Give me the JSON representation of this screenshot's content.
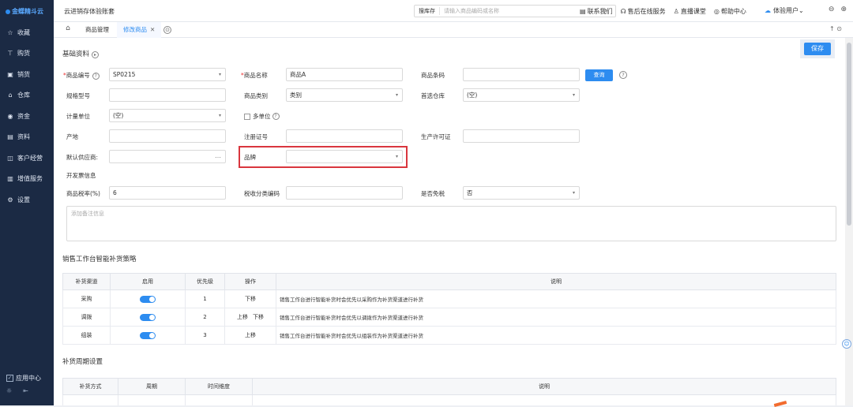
{
  "sidebar": {
    "logo": "金蝶精斗云",
    "items": [
      {
        "icon": "star-icon",
        "glyph": "☆",
        "label": "收藏"
      },
      {
        "icon": "cart-icon",
        "glyph": "⊤",
        "label": "购货"
      },
      {
        "icon": "sales-icon",
        "glyph": "▣",
        "label": "销货"
      },
      {
        "icon": "warehouse-icon",
        "glyph": "⌂",
        "label": "仓库"
      },
      {
        "icon": "money-icon",
        "glyph": "◉",
        "label": "资金"
      },
      {
        "icon": "data-icon",
        "glyph": "▤",
        "label": "资料"
      },
      {
        "icon": "customer-icon",
        "glyph": "◫",
        "label": "客户经营"
      },
      {
        "icon": "value-added-icon",
        "glyph": "▥",
        "label": "增值服务"
      },
      {
        "icon": "settings-icon",
        "glyph": "⚙",
        "label": "设置"
      }
    ],
    "app_center": "应用中心"
  },
  "topbar": {
    "title": "云进销存体验账套",
    "search_scope": "搜库存",
    "search_placeholder": "请输入商品编码或名称",
    "links": [
      "联系我们",
      "售后在线服务",
      "直播课堂",
      "帮助中心"
    ],
    "user": "体验用户"
  },
  "tabs": {
    "items": [
      {
        "label": "商品管理",
        "active": false
      },
      {
        "label": "修改商品",
        "active": true
      }
    ]
  },
  "basic_info": {
    "title": "基础资料",
    "save": "保存",
    "fields": {
      "code_label": "商品编号",
      "code_value": "SP0215",
      "name_label": "商品名称",
      "name_value": "商品A",
      "barcode_label": "商品条码",
      "barcode_value": "",
      "query_button": "查询",
      "spec_label": "规格型号",
      "category_label": "商品类别",
      "category_value": "类别",
      "preferred_warehouse_label": "首选仓库",
      "preferred_warehouse_value": "(空)",
      "unit_label": "计量单位",
      "unit_value": "(空)",
      "multi_unit_label": "多单位",
      "origin_label": "产地",
      "reg_cert_label": "注册证号",
      "license_label": "生产许可证",
      "supplier_label": "默认供应商:",
      "brand_label": "品牌",
      "invoice_section": "开发票信息",
      "tax_rate_label": "商品税率(%)",
      "tax_rate_value": "6",
      "tax_code_label": "税收分类编码",
      "tax_exempt_label": "是否免税",
      "tax_exempt_value": "否",
      "remark_placeholder": "添加备注信息"
    }
  },
  "strategy": {
    "title": "销售工作台智能补货策略",
    "headers": [
      "补货渠道",
      "启用",
      "优先级",
      "操作",
      "说明"
    ],
    "rows": [
      {
        "channel": "采购",
        "enabled": true,
        "priority": "1",
        "ops": [
          "下移"
        ],
        "desc": "销售工作台进行智能补货时会优先以采购作为补货渠道进行补货"
      },
      {
        "channel": "调拨",
        "enabled": true,
        "priority": "2",
        "ops": [
          "上移",
          "下移"
        ],
        "desc": "销售工作台进行智能补货时会优先以调拨作为补货渠道进行补货"
      },
      {
        "channel": "组装",
        "enabled": true,
        "priority": "3",
        "ops": [
          "上移"
        ],
        "desc": "销售工作台进行智能补货时会优先以组装作为补货渠道进行补货"
      }
    ]
  },
  "cycle": {
    "title": "补货周期设置",
    "headers": [
      "补货方式",
      "周期",
      "时间维度",
      "说明"
    ]
  },
  "colors": {
    "accent": "#2d8cf0",
    "highlight": "#d9363e",
    "sidebar": "#1b2a44"
  }
}
